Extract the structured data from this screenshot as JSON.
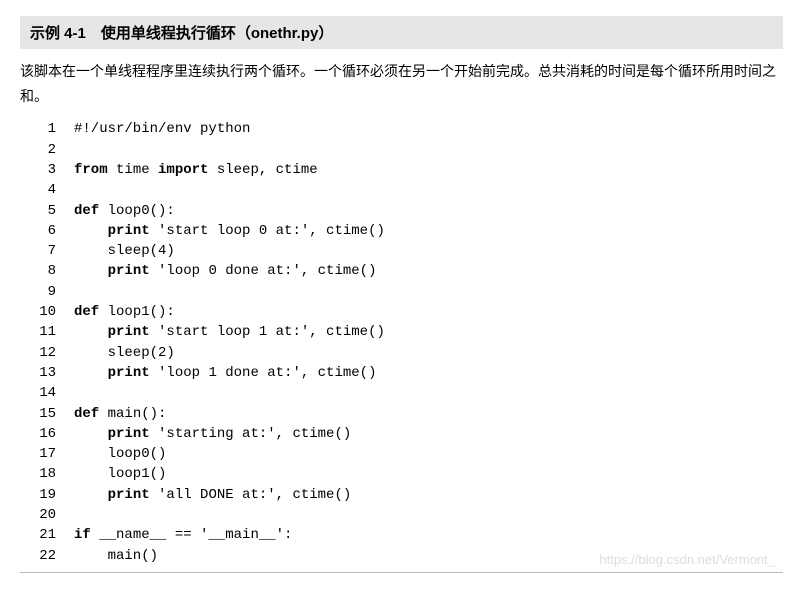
{
  "title": "示例 4-1　使用单线程执行循环（onethr.py）",
  "description": "该脚本在一个单线程程序里连续执行两个循环。一个循环必须在另一个开始前完成。总共消耗的时间是每个循环所用时间之和。",
  "watermark": "https://blog.csdn.net/Vermont_",
  "code": [
    {
      "n": 1,
      "tokens": [
        {
          "t": "#!/usr/bin/env python"
        }
      ]
    },
    {
      "n": 2,
      "tokens": [
        {
          "t": ""
        }
      ]
    },
    {
      "n": 3,
      "tokens": [
        {
          "t": "from ",
          "kw": true
        },
        {
          "t": "time "
        },
        {
          "t": "import ",
          "kw": true
        },
        {
          "t": "sleep, ctime"
        }
      ]
    },
    {
      "n": 4,
      "tokens": [
        {
          "t": ""
        }
      ]
    },
    {
      "n": 5,
      "tokens": [
        {
          "t": "def ",
          "kw": true
        },
        {
          "t": "loop0():"
        }
      ]
    },
    {
      "n": 6,
      "tokens": [
        {
          "t": "    "
        },
        {
          "t": "print ",
          "kw": true
        },
        {
          "t": "'start loop 0 at:', ctime()"
        }
      ]
    },
    {
      "n": 7,
      "tokens": [
        {
          "t": "    sleep(4)"
        }
      ]
    },
    {
      "n": 8,
      "tokens": [
        {
          "t": "    "
        },
        {
          "t": "print ",
          "kw": true
        },
        {
          "t": "'loop 0 done at:', ctime()"
        }
      ]
    },
    {
      "n": 9,
      "tokens": [
        {
          "t": ""
        }
      ]
    },
    {
      "n": 10,
      "tokens": [
        {
          "t": "def ",
          "kw": true
        },
        {
          "t": "loop1():"
        }
      ]
    },
    {
      "n": 11,
      "tokens": [
        {
          "t": "    "
        },
        {
          "t": "print ",
          "kw": true
        },
        {
          "t": "'start loop 1 at:', ctime()"
        }
      ]
    },
    {
      "n": 12,
      "tokens": [
        {
          "t": "    sleep(2)"
        }
      ]
    },
    {
      "n": 13,
      "tokens": [
        {
          "t": "    "
        },
        {
          "t": "print ",
          "kw": true
        },
        {
          "t": "'loop 1 done at:', ctime()"
        }
      ]
    },
    {
      "n": 14,
      "tokens": [
        {
          "t": ""
        }
      ]
    },
    {
      "n": 15,
      "tokens": [
        {
          "t": "def ",
          "kw": true
        },
        {
          "t": "main():"
        }
      ]
    },
    {
      "n": 16,
      "tokens": [
        {
          "t": "    "
        },
        {
          "t": "print ",
          "kw": true
        },
        {
          "t": "'starting at:', ctime()"
        }
      ]
    },
    {
      "n": 17,
      "tokens": [
        {
          "t": "    loop0()"
        }
      ]
    },
    {
      "n": 18,
      "tokens": [
        {
          "t": "    loop1()"
        }
      ]
    },
    {
      "n": 19,
      "tokens": [
        {
          "t": "    "
        },
        {
          "t": "print ",
          "kw": true
        },
        {
          "t": "'all DONE at:', ctime()"
        }
      ]
    },
    {
      "n": 20,
      "tokens": [
        {
          "t": ""
        }
      ]
    },
    {
      "n": 21,
      "tokens": [
        {
          "t": "if ",
          "kw": true
        },
        {
          "t": "__name__ == '__main__':"
        }
      ]
    },
    {
      "n": 22,
      "tokens": [
        {
          "t": "    main()"
        }
      ]
    }
  ]
}
